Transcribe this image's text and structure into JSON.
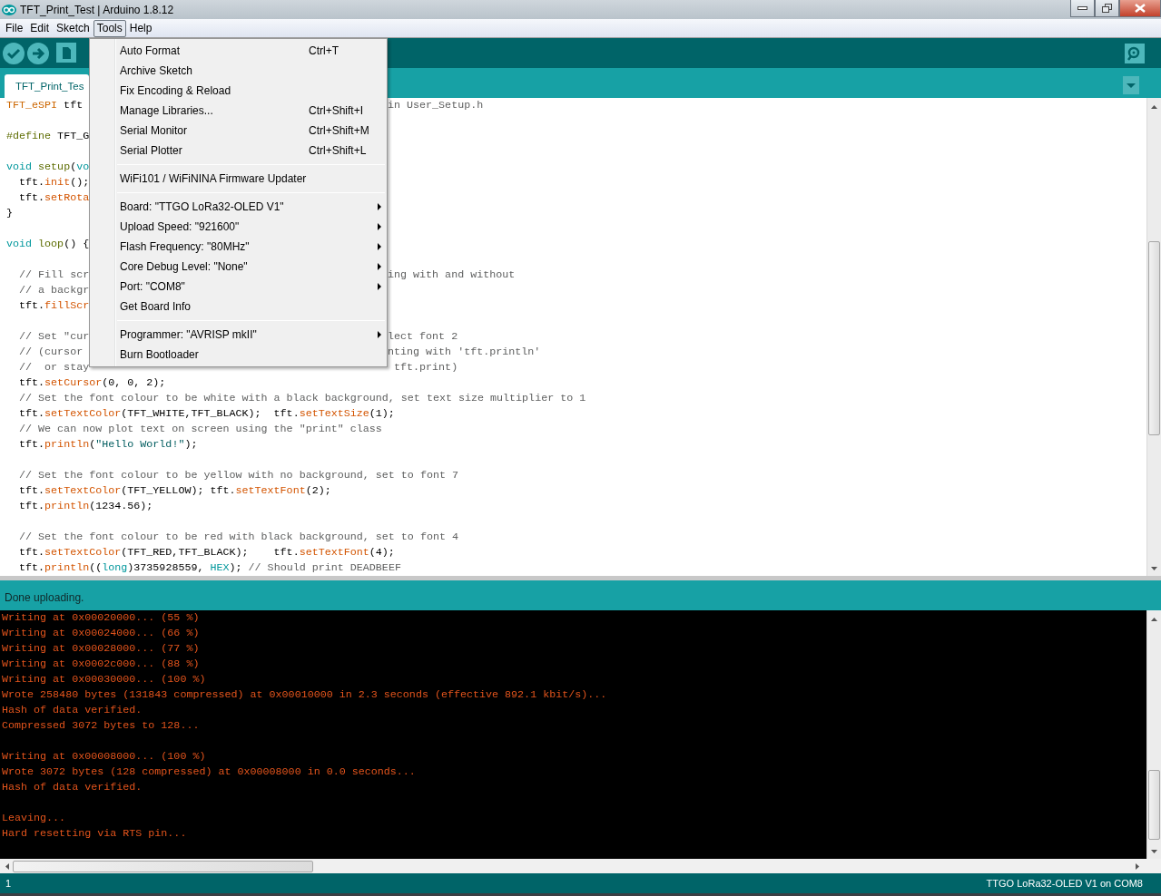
{
  "window": {
    "title": "TFT_Print_Test | Arduino 1.8.12"
  },
  "menubar": [
    {
      "label": "File",
      "selected": false
    },
    {
      "label": "Edit",
      "selected": false
    },
    {
      "label": "Sketch",
      "selected": false
    },
    {
      "label": "Tools",
      "selected": true
    },
    {
      "label": "Help",
      "selected": false
    }
  ],
  "tabs": [
    {
      "label": "TFT_Print_Tes",
      "selected": true
    }
  ],
  "editor_lines": [
    {
      "kind": "code",
      "tokens": [
        {
          "kind": "type",
          "text": "TFT_eSPI"
        },
        {
          "kind": "plain",
          "text": " tft"
        }
      ],
      "right_tokens": [
        {
          "kind": "comment",
          "text": "in User_Setup.h"
        }
      ]
    },
    {
      "kind": "blank"
    },
    {
      "kind": "code",
      "tokens": [
        {
          "kind": "directive",
          "text": "#define"
        },
        {
          "kind": "plain",
          "text": " TFT_G"
        }
      ]
    },
    {
      "kind": "blank"
    },
    {
      "kind": "code",
      "tokens": [
        {
          "kind": "keyword",
          "text": "void "
        },
        {
          "kind": "builtin",
          "text": "setup"
        },
        {
          "kind": "plain",
          "text": "("
        },
        {
          "kind": "keyword",
          "text": "vo"
        }
      ]
    },
    {
      "kind": "code",
      "tokens": [
        {
          "kind": "plain",
          "text": "  tft."
        },
        {
          "kind": "func",
          "text": "init"
        },
        {
          "kind": "plain",
          "text": "();"
        }
      ]
    },
    {
      "kind": "code",
      "tokens": [
        {
          "kind": "plain",
          "text": "  tft."
        },
        {
          "kind": "func",
          "text": "setRota"
        }
      ]
    },
    {
      "kind": "code",
      "tokens": [
        {
          "kind": "plain",
          "text": "}"
        }
      ]
    },
    {
      "kind": "blank"
    },
    {
      "kind": "code",
      "tokens": [
        {
          "kind": "keyword",
          "text": "void "
        },
        {
          "kind": "builtin",
          "text": "loop"
        },
        {
          "kind": "plain",
          "text": "() {"
        }
      ]
    },
    {
      "kind": "blank"
    },
    {
      "kind": "code",
      "tokens": [
        {
          "kind": "comment",
          "text": "  // Fill scr"
        }
      ],
      "right_tokens": [
        {
          "kind": "comment",
          "text": "ing with and without"
        }
      ]
    },
    {
      "kind": "code",
      "tokens": [
        {
          "kind": "comment",
          "text": "  // a backgr"
        }
      ]
    },
    {
      "kind": "code",
      "tokens": [
        {
          "kind": "plain",
          "text": "  tft."
        },
        {
          "kind": "func",
          "text": "fillScr"
        }
      ]
    },
    {
      "kind": "blank"
    },
    {
      "kind": "code",
      "tokens": [
        {
          "kind": "comment",
          "text": "  // Set \"cur"
        }
      ],
      "right_tokens": [
        {
          "kind": "comment",
          "text": "lect font 2"
        }
      ]
    },
    {
      "kind": "code",
      "tokens": [
        {
          "kind": "comment",
          "text": "  // (cursor"
        }
      ],
      "right_tokens": [
        {
          "kind": "comment",
          "text": "nting with 'tft.println'"
        }
      ]
    },
    {
      "kind": "code",
      "tokens": [
        {
          "kind": "comment",
          "text": "  //  or stay"
        }
      ],
      "right_tokens": [
        {
          "kind": "comment",
          "text": " tft.print)"
        }
      ]
    },
    {
      "kind": "code",
      "tokens": [
        {
          "kind": "plain",
          "text": "  tft."
        },
        {
          "kind": "func",
          "text": "setCursor"
        },
        {
          "kind": "plain",
          "text": "(0, 0, 2);"
        }
      ]
    },
    {
      "kind": "code",
      "tokens": [
        {
          "kind": "comment",
          "text": "  // Set the font colour to be white with a black background, set text size multiplier to 1"
        }
      ]
    },
    {
      "kind": "code",
      "tokens": [
        {
          "kind": "plain",
          "text": "  tft."
        },
        {
          "kind": "func",
          "text": "setTextColor"
        },
        {
          "kind": "plain",
          "text": "(TFT_WHITE,TFT_BLACK);  tft."
        },
        {
          "kind": "func",
          "text": "setTextSize"
        },
        {
          "kind": "plain",
          "text": "(1);"
        }
      ]
    },
    {
      "kind": "code",
      "tokens": [
        {
          "kind": "comment",
          "text": "  // We can now plot text on screen using the \"print\" class"
        }
      ]
    },
    {
      "kind": "code",
      "tokens": [
        {
          "kind": "plain",
          "text": "  tft."
        },
        {
          "kind": "func",
          "text": "println"
        },
        {
          "kind": "plain",
          "text": "("
        },
        {
          "kind": "string",
          "text": "\"Hello World!\""
        },
        {
          "kind": "plain",
          "text": ");"
        }
      ]
    },
    {
      "kind": "blank"
    },
    {
      "kind": "code",
      "tokens": [
        {
          "kind": "comment",
          "text": "  // Set the font colour to be yellow with no background, set to font 7"
        }
      ]
    },
    {
      "kind": "code",
      "tokens": [
        {
          "kind": "plain",
          "text": "  tft."
        },
        {
          "kind": "func",
          "text": "setTextColor"
        },
        {
          "kind": "plain",
          "text": "(TFT_YELLOW); tft."
        },
        {
          "kind": "func",
          "text": "setTextFont"
        },
        {
          "kind": "plain",
          "text": "(2);"
        }
      ]
    },
    {
      "kind": "code",
      "tokens": [
        {
          "kind": "plain",
          "text": "  tft."
        },
        {
          "kind": "func",
          "text": "println"
        },
        {
          "kind": "plain",
          "text": "(1234.56);"
        }
      ]
    },
    {
      "kind": "blank"
    },
    {
      "kind": "code",
      "tokens": [
        {
          "kind": "comment",
          "text": "  // Set the font colour to be red with black background, set to font 4"
        }
      ]
    },
    {
      "kind": "code",
      "tokens": [
        {
          "kind": "plain",
          "text": "  tft."
        },
        {
          "kind": "func",
          "text": "setTextColor"
        },
        {
          "kind": "plain",
          "text": "(TFT_RED,TFT_BLACK);    tft."
        },
        {
          "kind": "func",
          "text": "setTextFont"
        },
        {
          "kind": "plain",
          "text": "(4);"
        }
      ]
    },
    {
      "kind": "code",
      "tokens": [
        {
          "kind": "plain",
          "text": "  tft."
        },
        {
          "kind": "func",
          "text": "println"
        },
        {
          "kind": "plain",
          "text": "(("
        },
        {
          "kind": "keyword",
          "text": "long"
        },
        {
          "kind": "plain",
          "text": ")3735928559, "
        },
        {
          "kind": "constant",
          "text": "HEX"
        },
        {
          "kind": "plain",
          "text": "); "
        },
        {
          "kind": "comment",
          "text": "// Should print DEADBEEF"
        }
      ]
    }
  ],
  "tools_menu": [
    {
      "kind": "item",
      "label": "Auto Format",
      "shortcut": "Ctrl+T",
      "submenu": false
    },
    {
      "kind": "item",
      "label": "Archive Sketch",
      "submenu": false
    },
    {
      "kind": "item",
      "label": "Fix Encoding & Reload",
      "submenu": false
    },
    {
      "kind": "item",
      "label": "Manage Libraries...",
      "shortcut": "Ctrl+Shift+I",
      "submenu": false
    },
    {
      "kind": "item",
      "label": "Serial Monitor",
      "shortcut": "Ctrl+Shift+M",
      "submenu": false
    },
    {
      "kind": "item",
      "label": "Serial Plotter",
      "shortcut": "Ctrl+Shift+L",
      "submenu": false
    },
    {
      "kind": "separator"
    },
    {
      "kind": "item",
      "label": "WiFi101 / WiFiNINA Firmware Updater",
      "submenu": false
    },
    {
      "kind": "separator"
    },
    {
      "kind": "item",
      "label": "Board: \"TTGO LoRa32-OLED V1\"",
      "submenu": true
    },
    {
      "kind": "item",
      "label": "Upload Speed: \"921600\"",
      "submenu": true
    },
    {
      "kind": "item",
      "label": "Flash Frequency: \"80MHz\"",
      "submenu": true
    },
    {
      "kind": "item",
      "label": "Core Debug Level: \"None\"",
      "submenu": true
    },
    {
      "kind": "item",
      "label": "Port: \"COM8\"",
      "submenu": true
    },
    {
      "kind": "item",
      "label": "Get Board Info",
      "submenu": false
    },
    {
      "kind": "separator"
    },
    {
      "kind": "item",
      "label": "Programmer: \"AVRISP mkII\"",
      "submenu": true
    },
    {
      "kind": "item",
      "label": "Burn Bootloader",
      "submenu": false
    }
  ],
  "message": "Done uploading.",
  "console_lines": [
    {
      "kind": "text",
      "text": "Writing at 0x00020000... (55 %)"
    },
    {
      "kind": "text",
      "text": "Writing at 0x00024000... (66 %)"
    },
    {
      "kind": "text",
      "text": "Writing at 0x00028000... (77 %)"
    },
    {
      "kind": "text",
      "text": "Writing at 0x0002c000... (88 %)"
    },
    {
      "kind": "text",
      "text": "Writing at 0x00030000... (100 %)"
    },
    {
      "kind": "text",
      "text": "Wrote 258480 bytes (131843 compressed) at 0x00010000 in 2.3 seconds (effective 892.1 kbit/s)..."
    },
    {
      "kind": "text",
      "text": "Hash of data verified."
    },
    {
      "kind": "text",
      "text": "Compressed 3072 bytes to 128..."
    },
    {
      "kind": "blank"
    },
    {
      "kind": "text",
      "text": "Writing at 0x00008000... (100 %)"
    },
    {
      "kind": "text",
      "text": "Wrote 3072 bytes (128 compressed) at 0x00008000 in 0.0 seconds..."
    },
    {
      "kind": "text",
      "text": "Hash of data verified."
    },
    {
      "kind": "blank"
    },
    {
      "kind": "text",
      "text": "Leaving..."
    },
    {
      "kind": "text",
      "text": "Hard resetting via RTS pin..."
    }
  ],
  "status_bar": {
    "line": "1",
    "board": "TTGO LoRa32-OLED V1 on COM8"
  }
}
